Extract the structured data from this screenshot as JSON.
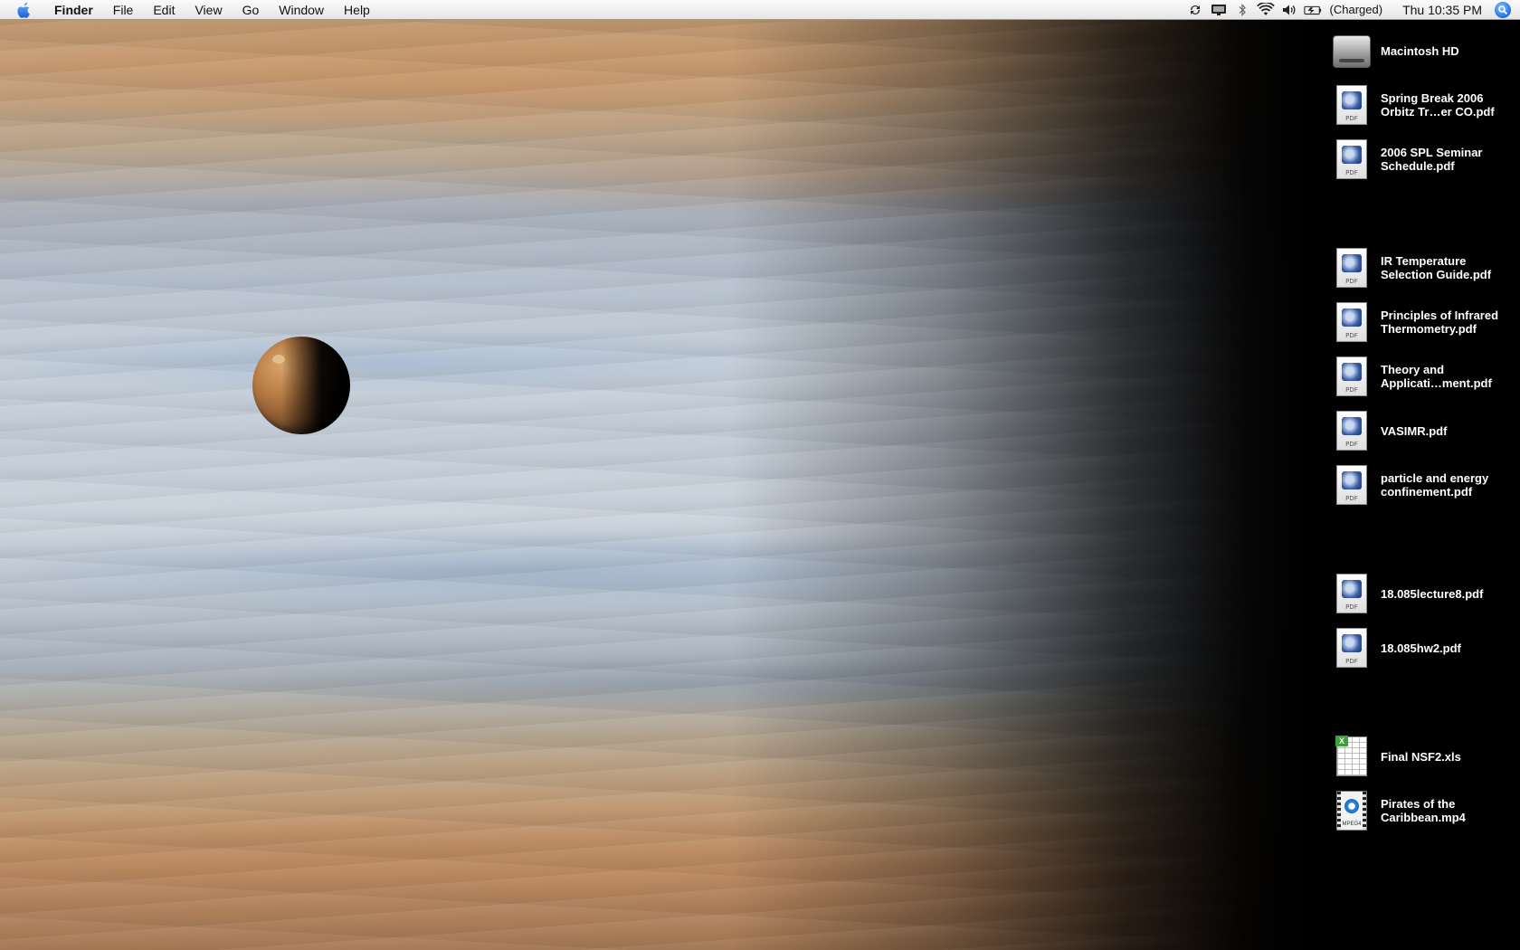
{
  "menubar": {
    "app_name": "Finder",
    "menus": [
      "File",
      "Edit",
      "View",
      "Go",
      "Window",
      "Help"
    ],
    "battery_status": "(Charged)",
    "clock": "Thu 10:35 PM",
    "status_icons": [
      "sync-icon",
      "display-icon",
      "bluetooth-icon",
      "wifi-icon",
      "volume-icon",
      "battery-icon",
      "spotlight-icon"
    ]
  },
  "desktop": {
    "wallpaper": "Jupiter with moon Io",
    "items": [
      {
        "label": "Macintosh HD",
        "type": "hard-drive"
      },
      {
        "label": "Spring Break 2006\nOrbitz Tr…er CO.pdf",
        "type": "pdf"
      },
      {
        "label": "2006 SPL Seminar\nSchedule.pdf",
        "type": "pdf"
      },
      {
        "label": "IR Temperature\nSelection Guide.pdf",
        "type": "pdf"
      },
      {
        "label": "Principles of Infrared\nThermometry.pdf",
        "type": "pdf"
      },
      {
        "label": "Theory and\nApplicati…ment.pdf",
        "type": "pdf"
      },
      {
        "label": "VASIMR.pdf",
        "type": "pdf"
      },
      {
        "label": "particle and energy\nconfinement.pdf",
        "type": "pdf"
      },
      {
        "label": "18.085lecture8.pdf",
        "type": "pdf"
      },
      {
        "label": "18.085hw2.pdf",
        "type": "pdf"
      },
      {
        "label": "Final NSF2.xls",
        "type": "xls"
      },
      {
        "label": "Pirates of the\nCaribbean.mp4",
        "type": "mp4"
      }
    ]
  }
}
